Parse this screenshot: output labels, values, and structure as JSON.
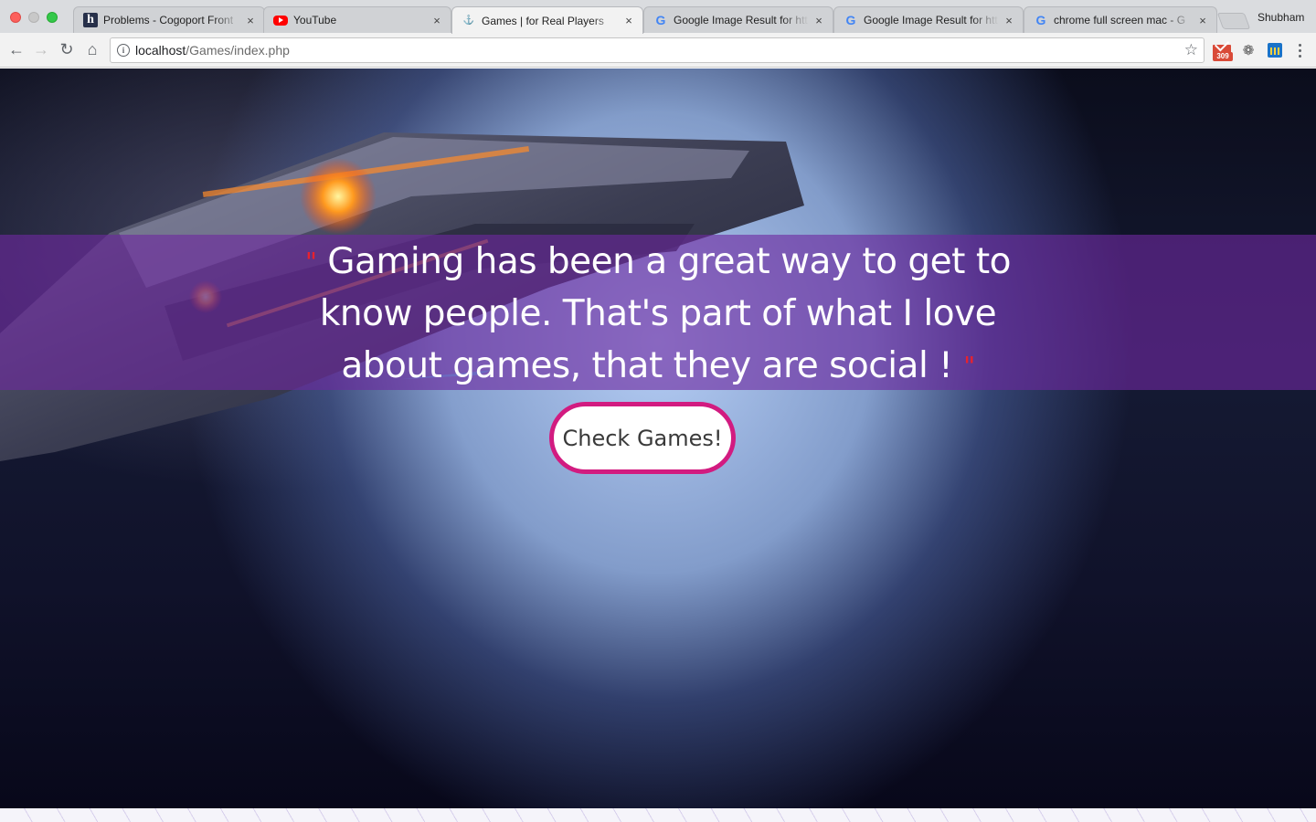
{
  "browser": {
    "tabs": [
      {
        "title": "Problems - Cogoport Front",
        "favicon": "hackerearth-h-icon",
        "active": false
      },
      {
        "title": "YouTube",
        "favicon": "youtube-icon",
        "active": false
      },
      {
        "title": "Games | for Real Players",
        "favicon": "game-site-icon",
        "active": true
      },
      {
        "title": "Google Image Result for htt",
        "favicon": "google-g-icon",
        "active": false
      },
      {
        "title": "Google Image Result for htt",
        "favicon": "google-g-icon",
        "active": false
      },
      {
        "title": "chrome full screen mac - G",
        "favicon": "google-g-icon",
        "active": false
      }
    ],
    "tab_close_glyph": "×",
    "profile_name": "Shubham",
    "url_host": "localhost",
    "url_path": "/Games/index.php",
    "mail_badge": "309",
    "fav_h": "h",
    "fav_g": "G",
    "fav_game": "⚓"
  },
  "hero": {
    "quote_open": "\"",
    "quote_text": "Gaming has been a great way to get to know people. That's part of what I love about games, that they are social !",
    "quote_close": "\"",
    "cta_label": "Check Games!"
  },
  "colors": {
    "quote_band": "#6e28a0",
    "cta_border": "#d21b80",
    "quote_marks": "#e8222e"
  }
}
